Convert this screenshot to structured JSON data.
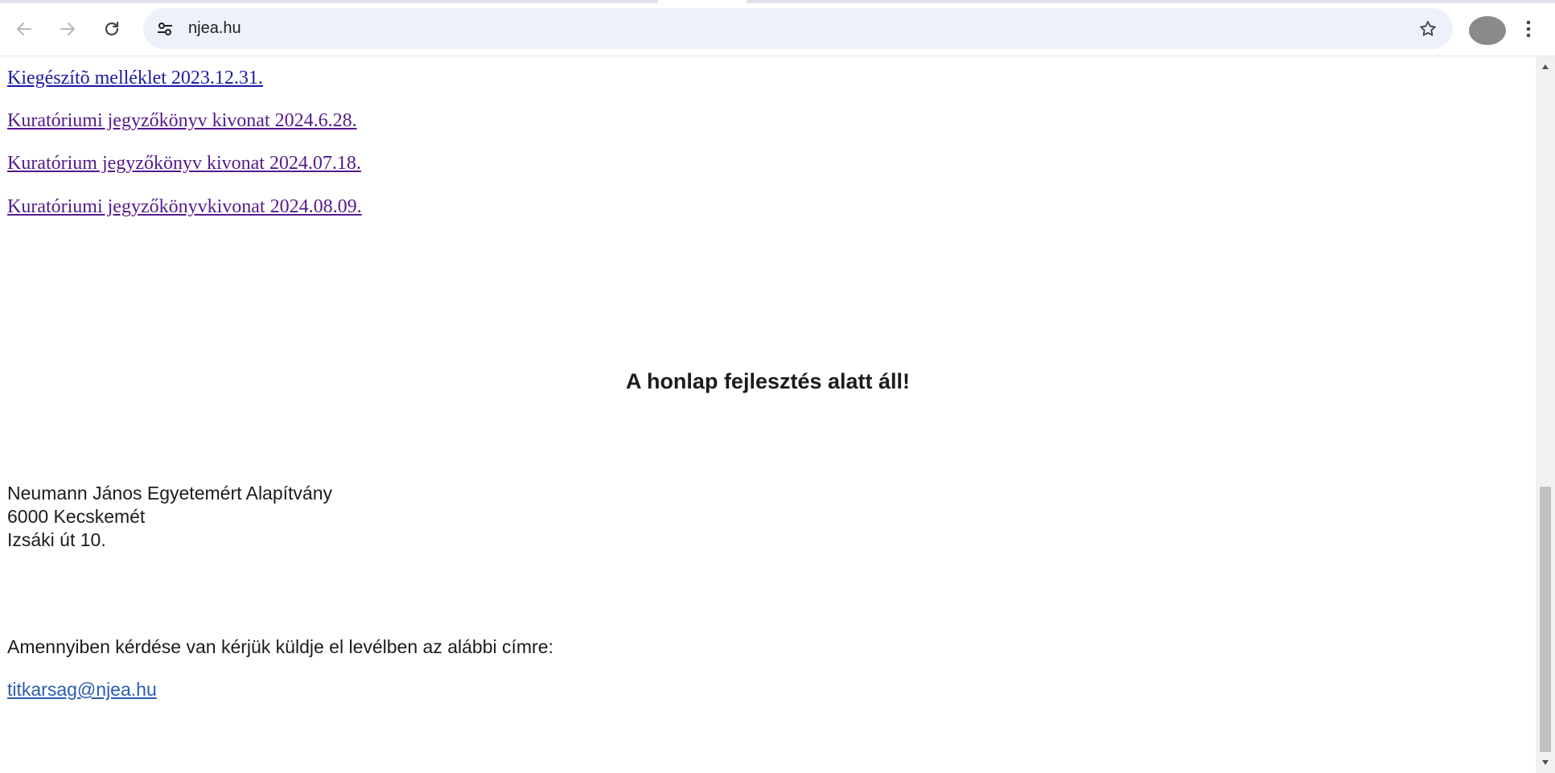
{
  "browser": {
    "url": "njea.hu",
    "icons": {
      "back": "arrow-left-icon",
      "forward": "arrow-right-icon",
      "reload": "reload-icon",
      "site_info": "tune-icon",
      "bookmark": "star-icon",
      "menu": "kebab-menu-icon"
    }
  },
  "page": {
    "links": [
      {
        "label": "Kiegészítõ melléklet 2023.12.31.",
        "state": "unvisited"
      },
      {
        "label": "Kuratóriumi jegyzőkönyv kivonat 2024.6.28.",
        "state": "visited"
      },
      {
        "label": "Kuratórium jegyzőkönyv kivonat 2024.07.18.",
        "state": "visited"
      },
      {
        "label": "Kuratóriumi jegyzőkönyvkivonat 2024.08.09.",
        "state": "visited"
      }
    ],
    "notice": "A honlap fejlesztés alatt áll!",
    "address": {
      "name": "Neumann János Egyetemért Alapítvány",
      "city": "6000 Kecskemét",
      "street": "Izsáki út 10."
    },
    "contact_text": "Amennyiben kérdése van kérjük küldje el levélben az alábbi címre:",
    "email": "titkarsag@njea.hu"
  },
  "colors": {
    "link_unvisited": "#1a1aa6",
    "link_visited": "#551a8b",
    "email_link": "#2a5db0",
    "omnibox_bg": "#edf2fa"
  }
}
